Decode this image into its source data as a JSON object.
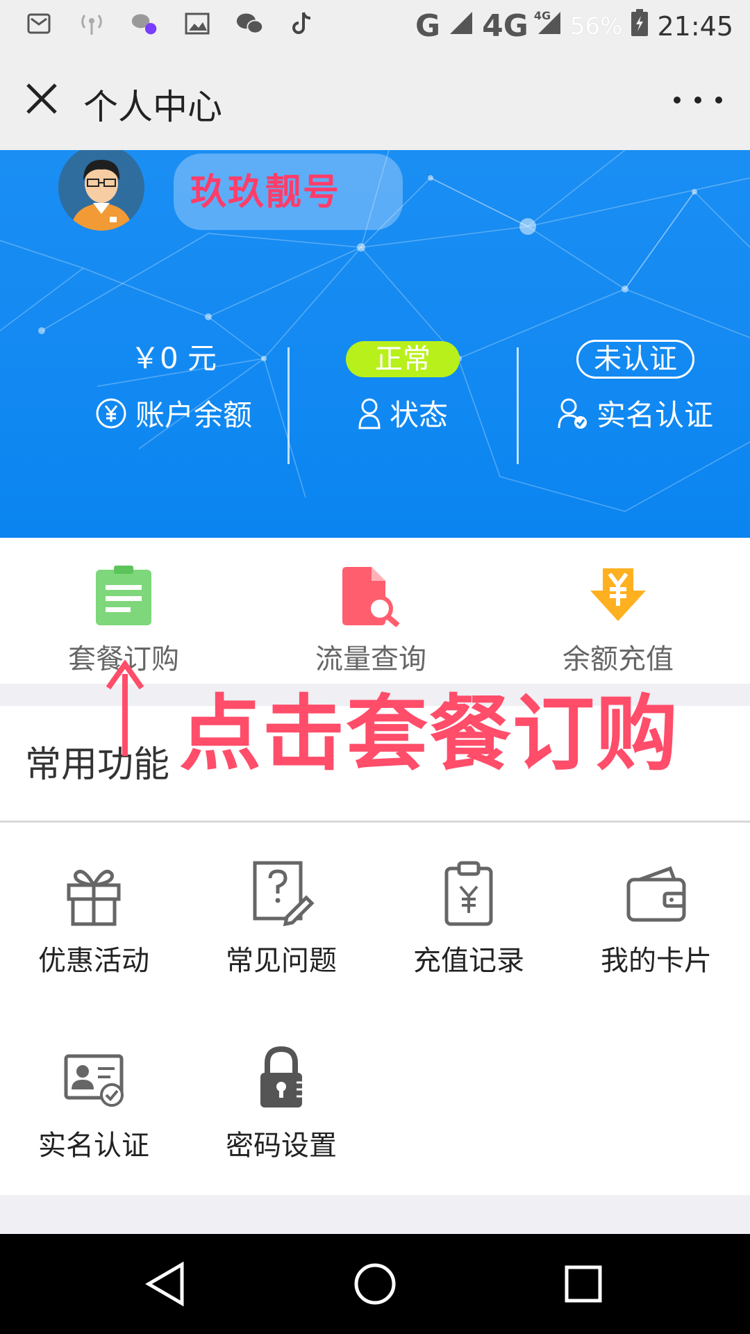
{
  "status_bar": {
    "network_1": "G",
    "network_2": "4G",
    "network_2_badge": "4G",
    "battery": "56%",
    "time": "21:45"
  },
  "titlebar": {
    "title": "个人中心"
  },
  "profile": {
    "username": "玖玖靓号"
  },
  "stats": {
    "balance_value": "￥0 元",
    "balance_label": "账户余额",
    "status_value": "正常",
    "status_label": "状态",
    "verify_value": "未认证",
    "verify_label": "实名认证"
  },
  "quick_actions": [
    {
      "label": "套餐订购"
    },
    {
      "label": "流量查询"
    },
    {
      "label": "余额充值"
    }
  ],
  "annotation": {
    "text": "点击套餐订购"
  },
  "common": {
    "title": "常用功能",
    "items": [
      {
        "label": "优惠活动"
      },
      {
        "label": "常见问题"
      },
      {
        "label": "充值记录"
      },
      {
        "label": "我的卡片"
      },
      {
        "label": "实名认证"
      },
      {
        "label": "密码设置"
      }
    ]
  },
  "colors": {
    "hero_blue": "#1289f2",
    "status_green": "#b8f01c",
    "annotation_red": "#ff4d6a",
    "quick_green": "#7ed77a",
    "quick_red": "#ff5e6e",
    "quick_orange": "#ffb020"
  }
}
